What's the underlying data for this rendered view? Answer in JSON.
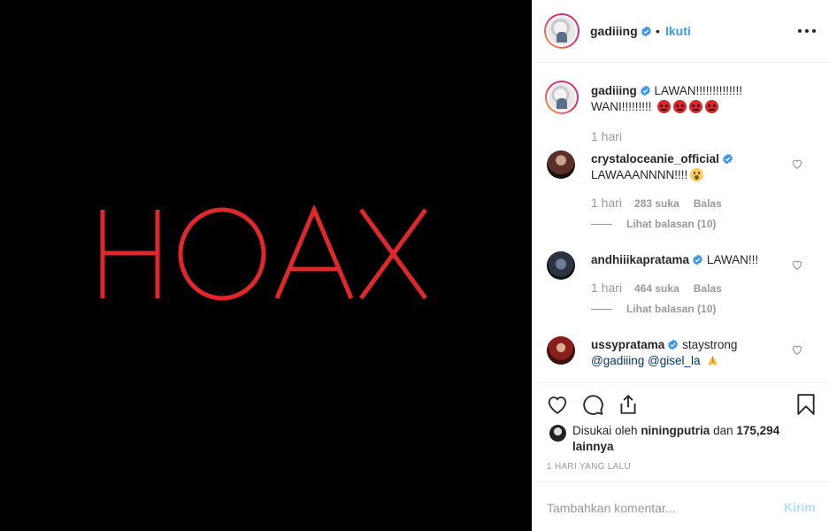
{
  "post": {
    "media_text": "HOAX",
    "colors": {
      "media_bg": "#000000",
      "media_text": "#e0282c",
      "accent": "#3897f0",
      "verified": "#3897f0"
    }
  },
  "header": {
    "username": "gadiiing",
    "separator": "•",
    "follow_label": "Ikuti",
    "more_icon": "more-horizontal-icon"
  },
  "caption": {
    "username": "gadiiing",
    "text": "LAWAN!!!!!!!!!!!!!! WANI!!!!!!!!!",
    "emojis": [
      "angry-face",
      "angry-face",
      "angry-face",
      "angry-face"
    ],
    "time": "1 hari"
  },
  "comments": [
    {
      "username": "crystaloceanie_official",
      "text": "LAWAAANNNN!!!!",
      "emoji": "shocked-face",
      "time": "1 hari",
      "likes": "283 suka",
      "reply_label": "Balas",
      "replies_label": "Lihat balasan (10)"
    },
    {
      "username": "andhiiikapratama",
      "text": "LAWAN!!!",
      "time": "1 hari",
      "likes": "464 suka",
      "reply_label": "Balas",
      "replies_label": "Lihat balasan (10)"
    },
    {
      "username": "ussypratama",
      "text": "staystrong",
      "mention1": "@gadiiing",
      "mention2": "@gisel_la",
      "emoji": "folded-hands"
    }
  ],
  "actions": {
    "like_icon": "heart-icon",
    "comment_icon": "comment-icon",
    "share_icon": "share-icon",
    "save_icon": "bookmark-icon"
  },
  "likes": {
    "prefix": "Disukai oleh",
    "user": "niningputria",
    "conj": "dan",
    "others": "175,294 lainnya"
  },
  "timestamp": "1 HARI YANG LALU",
  "add_comment": {
    "placeholder": "Tambahkan komentar...",
    "send_label": "Kirim"
  }
}
